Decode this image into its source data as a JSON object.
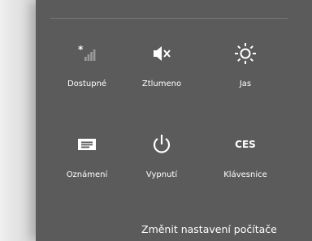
{
  "charms_settings": {
    "tiles": [
      {
        "label": "Dostupné",
        "icon": "network-signal-icon"
      },
      {
        "label": "Ztlumeno",
        "icon": "volume-muted-icon"
      },
      {
        "label": "Jas",
        "icon": "brightness-icon"
      },
      {
        "label": "Oznámení",
        "icon": "notifications-icon"
      },
      {
        "label": "Vypnutí",
        "icon": "power-icon"
      },
      {
        "label": "Klávesnice",
        "icon": "keyboard-language"
      }
    ],
    "keyboard_layout": "CES",
    "change_pc_settings": "Změnit nastavení počítače"
  },
  "colors": {
    "panel": "#5b5b5b",
    "text": "#ffffff",
    "background": "#e6e6e6"
  }
}
